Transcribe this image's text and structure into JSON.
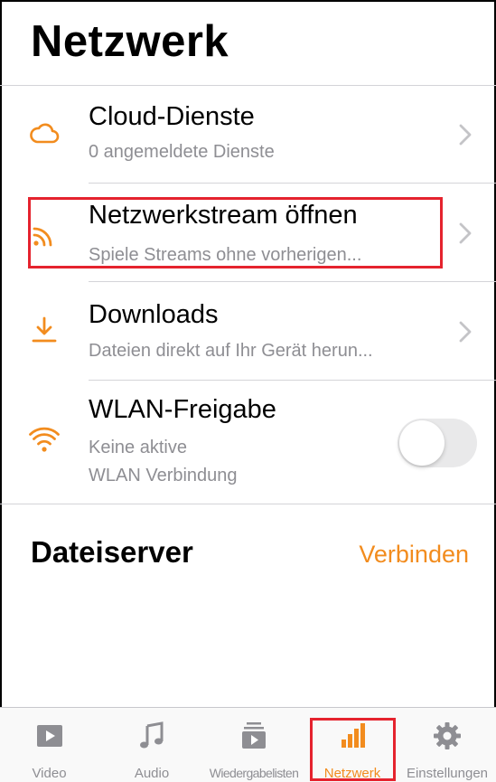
{
  "header": {
    "title": "Netzwerk"
  },
  "rows": [
    {
      "title": "Cloud-Dienste",
      "subtitle": "0 angemeldete Dienste",
      "icon": "cloud-icon"
    },
    {
      "title": "Netzwerkstream öffnen",
      "subtitle": "Spiele Streams ohne vorherigen...",
      "icon": "rss-icon"
    },
    {
      "title": "Downloads",
      "subtitle": "Dateien direkt auf Ihr Gerät herun...",
      "icon": "download-icon"
    },
    {
      "title": "WLAN-Freigabe",
      "subtitle_line1": "Keine aktive",
      "subtitle_line2": "WLAN Verbindung",
      "icon": "wifi-icon",
      "toggle_on": false
    }
  ],
  "fileserver": {
    "title": "Dateiserver",
    "connect_label": "Verbinden"
  },
  "tabs": [
    {
      "label": "Video",
      "icon": "play-icon",
      "active": false
    },
    {
      "label": "Audio",
      "icon": "music-note-icon",
      "active": false
    },
    {
      "label": "Wiedergabelisten",
      "icon": "playlist-icon",
      "active": false
    },
    {
      "label": "Netzwerk",
      "icon": "signal-bars-icon",
      "active": true
    },
    {
      "label": "Einstellungen",
      "icon": "gear-icon",
      "active": false
    }
  ],
  "colors": {
    "accent": "#f28c1e",
    "highlight": "#e5232e",
    "secondary_text": "#8e8e93",
    "separator": "#d4d4d8"
  }
}
